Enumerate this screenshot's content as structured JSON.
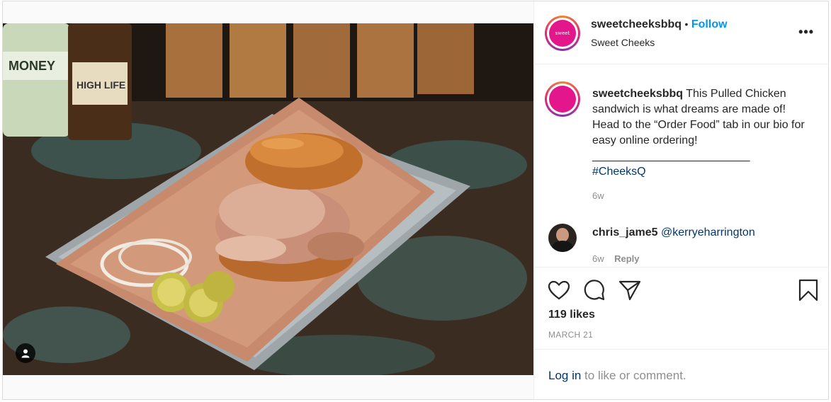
{
  "post": {
    "username": "sweetcheeksbbq",
    "follow_label": "Follow",
    "dot": "•",
    "location": "Sweet Cheeks",
    "avatar_text": "sweet cheeks Q",
    "more_label": "•••",
    "caption_user": "sweetcheeksbbq",
    "caption_text": " This Pulled Chicken sandwich is what dreams are made of! Head to the “Order Food” tab in our bio for easy online ordering!",
    "caption_divider": "_________________________",
    "hashtag": "#CheeksQ",
    "caption_time": "6w"
  },
  "comment": {
    "username": "chris_jame5",
    "mention": "@kerryeharrington",
    "time": "6w",
    "reply_label": "Reply"
  },
  "actions": {
    "like_icon": "heart-icon",
    "comment_icon": "comment-icon",
    "share_icon": "share-icon",
    "save_icon": "bookmark-icon"
  },
  "likes": "119 likes",
  "date": "MARCH 21",
  "login": {
    "link_label": "Log in",
    "suffix": " to like or comment."
  },
  "colors": {
    "follow": "#0095f6",
    "brand_pink": "#e3168c",
    "link_dark": "#00376b",
    "muted": "#8e8e8e"
  }
}
